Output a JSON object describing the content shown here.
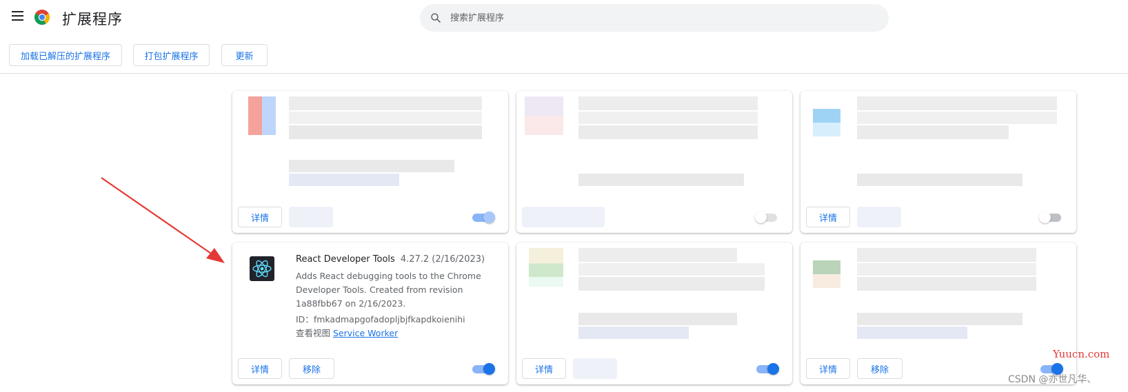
{
  "header": {
    "title": "扩展程序",
    "search_placeholder": "搜索扩展程序"
  },
  "toolbar": {
    "load_unpacked": "加载已解压的扩展程序",
    "pack_extension": "打包扩展程序",
    "update": "更新"
  },
  "extension": {
    "name": "React Developer Tools",
    "version": "4.27.2 (2/16/2023)",
    "description": "Adds React debugging tools to the Chrome Developer Tools. Created from revision 1a88fbb67 on 2/16/2023.",
    "id_label": "ID：",
    "id": "fmkadmapgofadopljbjfkapdkoienihi",
    "views_label": "查看视图",
    "views_link": "Service Worker",
    "enabled": true
  },
  "cards": [
    {
      "details": "详情",
      "enabled": true
    },
    {
      "details": "",
      "enabled": false
    },
    {
      "details": "详情",
      "enabled": false
    },
    {
      "details": "详情",
      "remove": "移除",
      "enabled": true
    },
    {
      "details": "详情",
      "enabled": true
    },
    {
      "details": "详情",
      "remove": "移除",
      "enabled": true
    }
  ],
  "watermarks": {
    "site": "Yuucn.com",
    "csdn": "CSDN @亦世凡华、"
  },
  "colors": {
    "accent": "#1a73e8",
    "annotation_arrow": "#e53935"
  }
}
